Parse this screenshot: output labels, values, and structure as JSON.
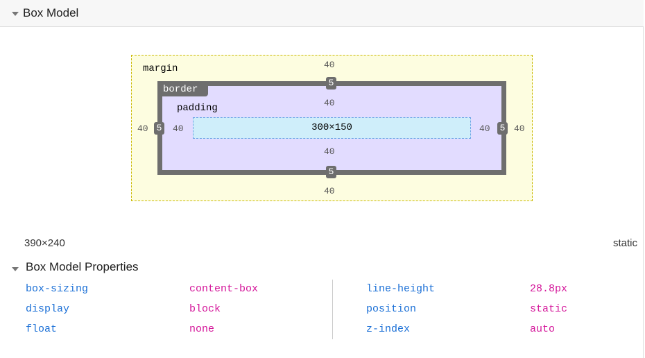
{
  "header": {
    "title": "Box Model"
  },
  "box_model": {
    "margin": {
      "label": "margin",
      "top": "40",
      "right": "40",
      "bottom": "40",
      "left": "40"
    },
    "border": {
      "label": "border",
      "top": "5",
      "right": "5",
      "bottom": "5",
      "left": "5"
    },
    "padding": {
      "label": "padding",
      "top": "40",
      "right": "40",
      "bottom": "40",
      "left": "40"
    },
    "content": {
      "size": "300×150"
    }
  },
  "summary": {
    "dimensions": "390×240",
    "position": "static"
  },
  "properties": {
    "title": "Box Model Properties",
    "rows": [
      {
        "name": "box-sizing",
        "value": "content-box"
      },
      {
        "name": "display",
        "value": "block"
      },
      {
        "name": "float",
        "value": "none"
      },
      {
        "name": "line-height",
        "value": "28.8px"
      },
      {
        "name": "position",
        "value": "static"
      },
      {
        "name": "z-index",
        "value": "auto"
      }
    ]
  },
  "colors": {
    "margin_bg": "#fdfde0",
    "padding_bg": "#e2dcff",
    "content_bg": "#cfeefa",
    "border": "#6e6e6e",
    "prop_name": "#1a6fd6",
    "prop_value": "#d4169a"
  }
}
